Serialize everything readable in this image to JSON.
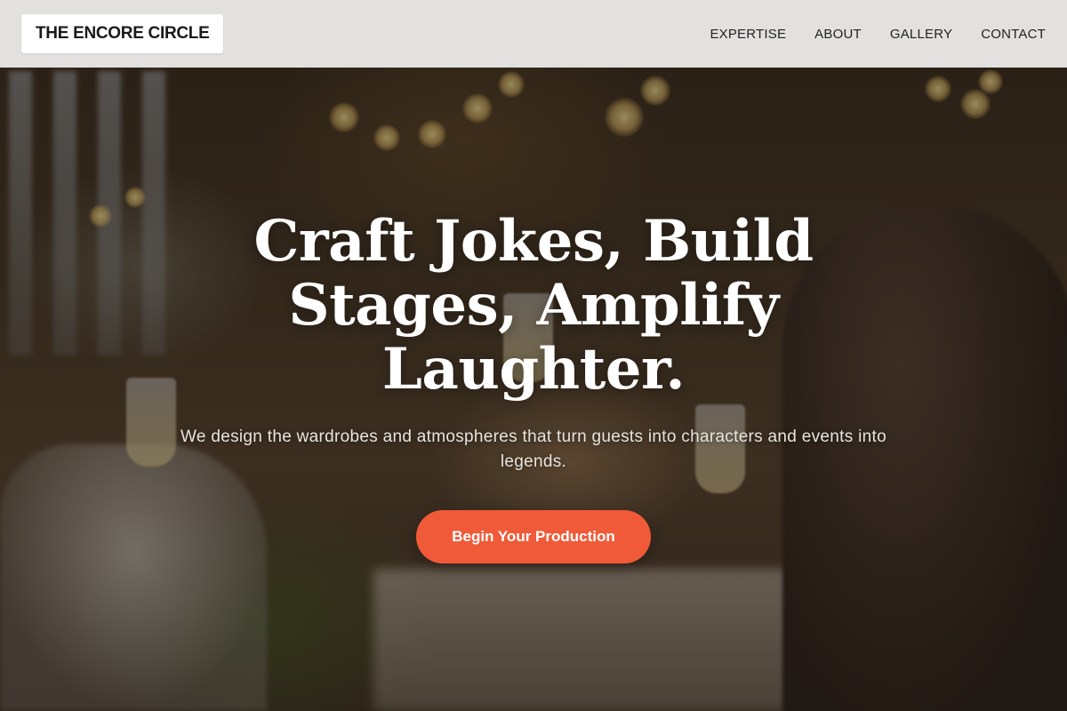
{
  "brand": {
    "name": "THE ENCORE CIRCLE"
  },
  "nav": {
    "items": [
      {
        "label": "EXPERTISE"
      },
      {
        "label": "ABOUT"
      },
      {
        "label": "GALLERY"
      },
      {
        "label": "CONTACT"
      }
    ]
  },
  "hero": {
    "title": "Craft Jokes, Build Stages, Amplify Laughter.",
    "subtitle": "We design the wardrobes and atmospheres that turn guests into characters and events into legends.",
    "cta_label": "Begin Your Production",
    "background": "wedding-celebration-toast-photo"
  },
  "colors": {
    "accent": "#f05a38",
    "header_bg": "#f0f0f0",
    "title_text": "#ffffff"
  }
}
